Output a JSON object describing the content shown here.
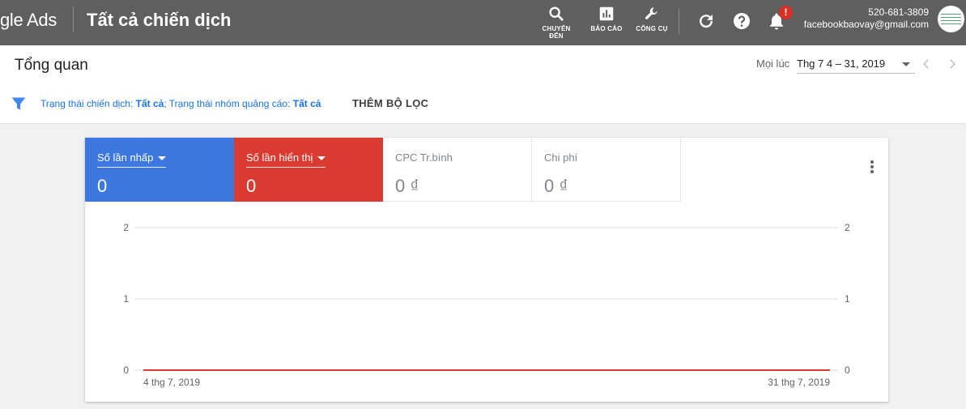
{
  "header": {
    "brand": "gle Ads",
    "page_title": "Tất cả chiến dịch",
    "tools": [
      {
        "label": "CHUYỂN ĐẾN",
        "icon": "search-icon"
      },
      {
        "label": "BÁO CÁO",
        "icon": "reports-icon"
      },
      {
        "label": "CÔNG CỤ",
        "icon": "wrench-icon"
      }
    ],
    "notification_badge": "!",
    "account_id": "520-681-3809",
    "account_email": "facebookbaovay@gmail.com"
  },
  "overview": {
    "title": "Tổng quan",
    "date_label": "Mọi lúc",
    "date_range": "Thg 7 4 – 31, 2019"
  },
  "filter": {
    "campaign_status_label": "Trạng thái chiến dịch: ",
    "campaign_status_value": "Tất cả",
    "separator": "; ",
    "adgroup_status_label": "Trạng thái nhóm quảng cáo: ",
    "adgroup_status_value": "Tất cả",
    "add_filter": "THÊM BỘ LỌC"
  },
  "metrics": [
    {
      "name": "Số lần nhấp",
      "value": "0",
      "color": "#3c78e0"
    },
    {
      "name": "Số lần hiển thị",
      "value": "0",
      "color": "#d93b30"
    },
    {
      "name": "CPC Tr.bình",
      "value": "0 ₫"
    },
    {
      "name": "Chi phí",
      "value": "0 ₫"
    }
  ],
  "chart_data": {
    "type": "line",
    "x": [
      "2019-07-04",
      "2019-07-31"
    ],
    "x_tick_labels": [
      "4 thg 7, 2019",
      "31 thg 7, 2019"
    ],
    "series": [
      {
        "name": "Số lần nhấp",
        "values": [
          0,
          0
        ],
        "color": "#3c78e0"
      },
      {
        "name": "Số lần hiển thị",
        "values": [
          0,
          0
        ],
        "color": "#d93b30"
      }
    ],
    "ylim": [
      0,
      2
    ],
    "y_ticks": [
      0,
      1,
      2
    ],
    "y2_ticks": [
      0,
      1,
      2
    ],
    "grid": true
  }
}
